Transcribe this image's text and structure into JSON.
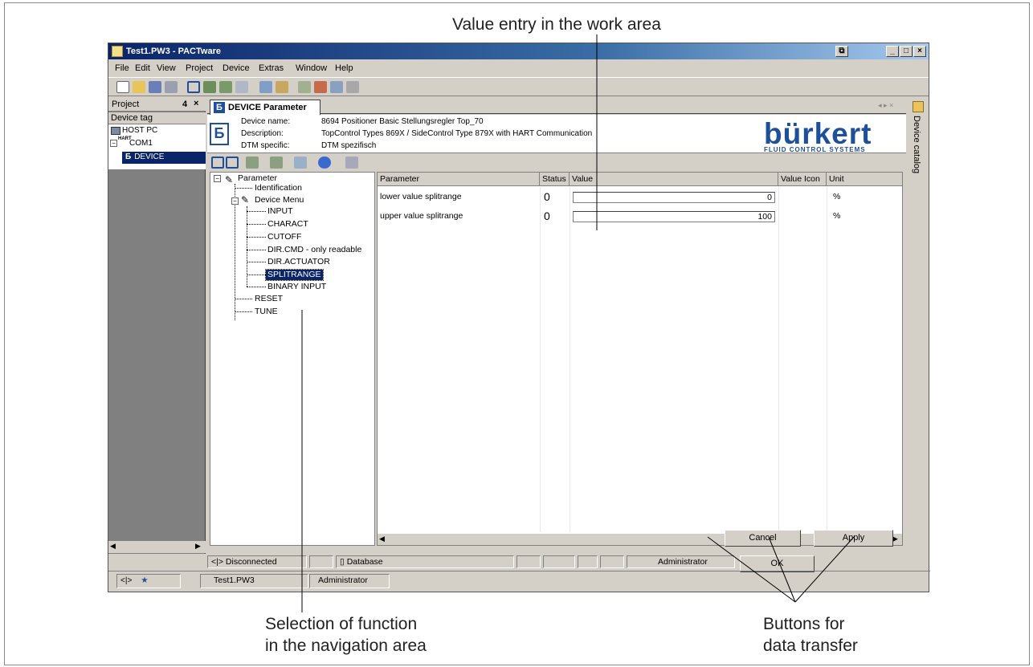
{
  "callouts": {
    "top": "Value entry in the work area",
    "left_line1": "Selection of function",
    "left_line2": "in the navigation area",
    "right_line1": "Buttons for",
    "right_line2": "data transfer"
  },
  "window": {
    "title": "Test1.PW3 - PACTware",
    "minimize": "_",
    "maximize": "□",
    "close": "×"
  },
  "menu": [
    "File",
    "Edit",
    "View",
    "Project",
    "Device",
    "Extras",
    "Window",
    "Help"
  ],
  "project_panel": {
    "title": "Project",
    "pin": "4",
    "close": "×",
    "column": "Device tag",
    "items": [
      "HOST PC",
      "COM1",
      "DEVICE"
    ],
    "com_badge": "HART"
  },
  "device_tab": {
    "title": "DEVICE Parameter",
    "nav_arrows": "◂ ▸ ×"
  },
  "device_info": {
    "name_label": "Device name:",
    "name_value": "8694 Positioner Basic Stellungsregler Top_70",
    "desc_label": "Description:",
    "desc_value": "TopControl Types 869X / SideControl Type 879X  with HART Communication",
    "dtm_label": "DTM specific:",
    "dtm_value": "DTM spezifisch",
    "brand": "bürkert",
    "brand_sub": "FLUID CONTROL SYSTEMS"
  },
  "nav_tree": {
    "root": "Parameter",
    "identification": "Identification",
    "device_menu": "Device Menu",
    "items": [
      "INPUT",
      "CHARACT",
      "CUTOFF",
      "DIR.CMD - only readable",
      "DIR.ACTUATOR",
      "SPLITRANGE",
      "BINARY INPUT"
    ],
    "selected": "SPLITRANGE",
    "reset": "RESET",
    "tune": "TUNE"
  },
  "table": {
    "headers": [
      "Parameter",
      "Status",
      "Value",
      "Value Icon",
      "Unit"
    ],
    "rows": [
      {
        "parameter": "lower value splitrange",
        "status": "0",
        "value": "0",
        "unit": "%"
      },
      {
        "parameter": "upper value splitrange",
        "status": "0",
        "value": "100",
        "unit": "%"
      }
    ]
  },
  "buttons": {
    "ok": "OK",
    "cancel": "Cancel",
    "apply": "Apply"
  },
  "status": {
    "connection": "Disconnected",
    "database": "Database",
    "user": "Administrator"
  },
  "bottom": {
    "project_file": "Test1.PW3",
    "user": "Administrator"
  },
  "catalog": {
    "label": "Device catalog"
  },
  "colors": {
    "selection": "#0a246a",
    "brand": "#1f4f9a",
    "titlebar": "#0a246a",
    "chrome": "#d4d0c8"
  }
}
